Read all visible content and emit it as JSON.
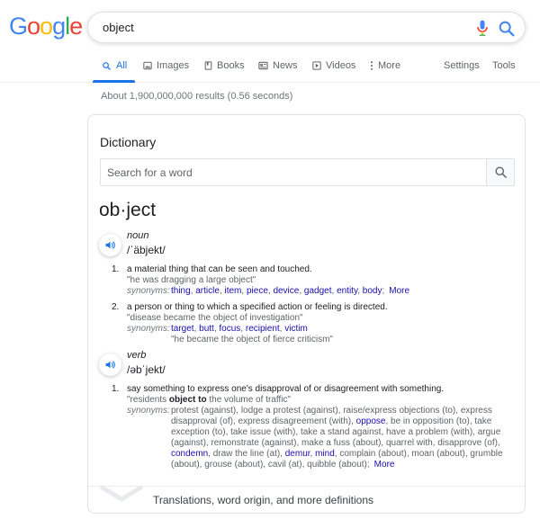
{
  "logo": {
    "letters": [
      "G",
      "o",
      "o",
      "g",
      "l",
      "e"
    ],
    "colors": [
      "#4285f4",
      "#ea4335",
      "#fbbc05",
      "#4285f4",
      "#34a853",
      "#ea4335"
    ]
  },
  "search": {
    "query": "object"
  },
  "tabs": {
    "all": "All",
    "images": "Images",
    "books": "Books",
    "news": "News",
    "videos": "Videos",
    "more": "More",
    "settings": "Settings",
    "tools": "Tools"
  },
  "result_stats": "About 1,900,000,000 results (0.56 seconds)",
  "dictionary": {
    "title": "Dictionary",
    "search_placeholder": "Search for a word",
    "headword": "ob·ject",
    "noun": {
      "pos": "noun",
      "pron": "/ˈäbjekt/",
      "senses": [
        {
          "num": "1.",
          "def": "a material thing that can be seen and touched.",
          "example": "\"he was dragging a large object\"",
          "syn_label": "synonyms:",
          "synonyms": [
            "thing",
            "article",
            "item",
            "piece",
            "device",
            "gadget",
            "entity",
            "body"
          ],
          "more": "More"
        },
        {
          "num": "2.",
          "def": "a person or thing to which a specified action or feeling is directed.",
          "example": "\"disease became the object of investigation\"",
          "syn_label": "synonyms:",
          "synonyms": [
            "target",
            "butt",
            "focus",
            "recipient",
            "victim"
          ],
          "sub_example": "\"he became the object of fierce criticism\""
        }
      ]
    },
    "verb": {
      "pos": "verb",
      "pron": "/əbˈjekt/",
      "sense": {
        "num": "1.",
        "def": "say something to express one's disapproval of or disagreement with something.",
        "example_pre": "\"residents ",
        "example_bold": "object to",
        "example_post": " the volume of traffic\"",
        "syn_label": "synonyms:",
        "syn_a": "protest (against), lodge a protest (against), raise/express objections (to), express disapproval (of), express disagreement (with), ",
        "syn_link1": "oppose",
        "syn_b": ", be in opposition (to), take exception (to), take issue (with), take a stand against, have a problem (with), argue (against), remonstrate (against), make a fuss (about), quarrel with, disapprove (of), ",
        "syn_link2": "condemn",
        "syn_c": ", draw the line (at), ",
        "syn_link3": "demur",
        "syn_d": ", ",
        "syn_link4": "mind",
        "syn_e": ", complain (about), moan (about), grumble (about), grouse (about), cavil (at), quibble (about);",
        "more": "More"
      }
    },
    "footer": "Translations, word origin, and more definitions"
  }
}
